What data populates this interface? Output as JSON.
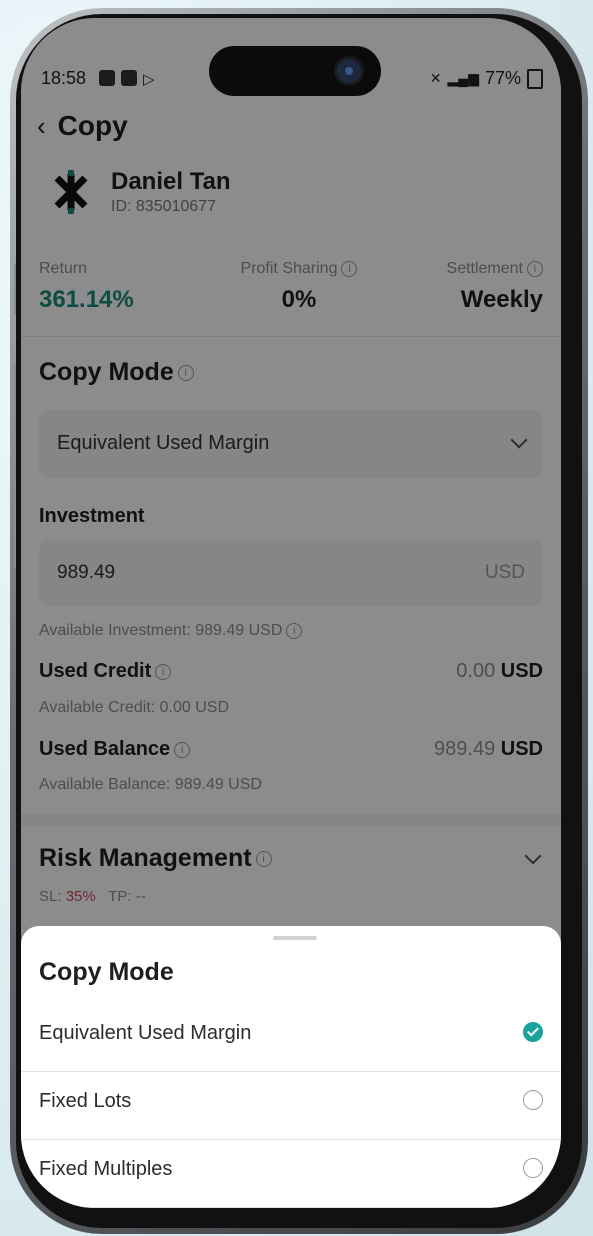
{
  "status_bar": {
    "time": "18:58",
    "battery": "77%"
  },
  "header": {
    "back_icon": "chevron-left-icon",
    "title": "Copy"
  },
  "trader": {
    "name": "Daniel Tan",
    "id_text": "ID: 835010677"
  },
  "stats": [
    {
      "label": "Return",
      "value": "361.14%",
      "color": "#1a8a7a"
    },
    {
      "label": "Profit Sharing",
      "value": "0%"
    },
    {
      "label": "Settlement",
      "value": "Weekly"
    }
  ],
  "copy_mode": {
    "title": "Copy Mode",
    "selected": "Equivalent Used Margin"
  },
  "investment": {
    "title": "Investment",
    "value": "989.49",
    "unit": "USD",
    "available": "Available Investment: 989.49 USD"
  },
  "used_credit": {
    "label": "Used Credit",
    "value": "0.00",
    "unit": "USD",
    "available": "Available Credit: 0.00 USD"
  },
  "used_balance": {
    "label": "Used Balance",
    "value": "989.49",
    "unit": "USD",
    "available": "Available Balance: 989.49 USD"
  },
  "risk": {
    "title": "Risk Management",
    "sl_label": "SL:",
    "sl_value": "35%",
    "tp_label": "TP:",
    "tp_value": "--",
    "sl_color": "#d0485e"
  },
  "sheet": {
    "title": "Copy Mode",
    "options": [
      {
        "label": "Equivalent Used Margin",
        "selected": true
      },
      {
        "label": "Fixed Lots",
        "selected": false
      },
      {
        "label": "Fixed Multiples",
        "selected": false
      }
    ],
    "accent": "#1aa39a"
  }
}
